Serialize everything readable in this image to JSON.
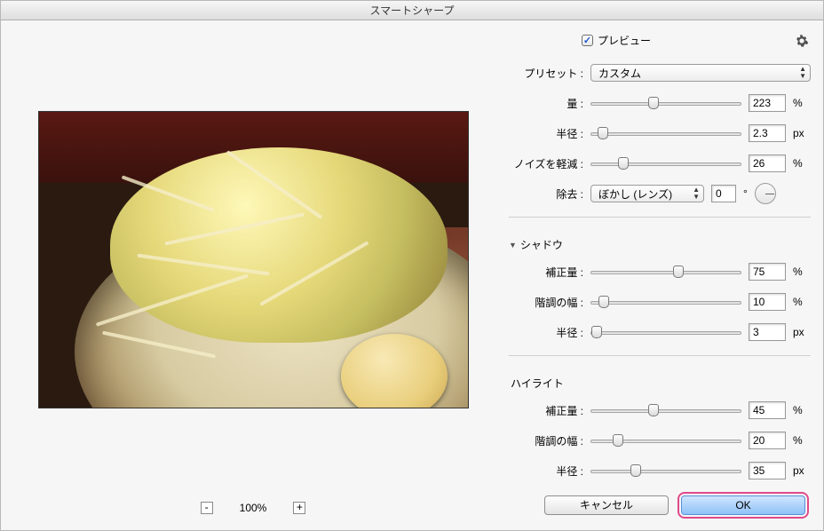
{
  "title": "スマートシャープ",
  "preview_label": "プレビュー",
  "preset": {
    "label": "プリセット :",
    "value": "カスタム"
  },
  "basic": {
    "amount": {
      "label": "量 :",
      "value": "223",
      "unit": "%",
      "pos": 42
    },
    "radius": {
      "label": "半径 :",
      "value": "2.3",
      "unit": "px",
      "pos": 8
    },
    "noise": {
      "label": "ノイズを軽減 :",
      "value": "26",
      "unit": "%",
      "pos": 22
    }
  },
  "remove": {
    "label": "除去 :",
    "value": "ぼかし (レンズ)",
    "angle": "0",
    "degree": "°"
  },
  "shadow": {
    "title": "シャドウ",
    "fade": {
      "label": "補正量 :",
      "value": "75",
      "unit": "%",
      "pos": 58
    },
    "tonal": {
      "label": "階調の幅 :",
      "value": "10",
      "unit": "%",
      "pos": 9
    },
    "radius": {
      "label": "半径 :",
      "value": "3",
      "unit": "px",
      "pos": 4
    }
  },
  "highlight": {
    "title": "ハイライト",
    "fade": {
      "label": "補正量 :",
      "value": "45",
      "unit": "%",
      "pos": 42
    },
    "tonal": {
      "label": "階調の幅 :",
      "value": "20",
      "unit": "%",
      "pos": 18
    },
    "radius": {
      "label": "半径 :",
      "value": "35",
      "unit": "px",
      "pos": 30
    }
  },
  "zoom": "100%",
  "buttons": {
    "cancel": "キャンセル",
    "ok": "OK"
  }
}
